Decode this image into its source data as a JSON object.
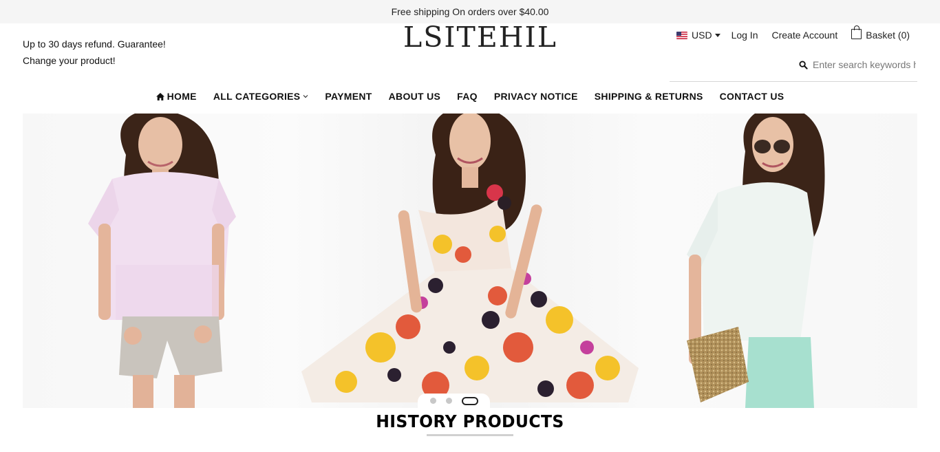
{
  "topbar": {
    "text": "Free shipping On orders over $40.00"
  },
  "promo": {
    "line1": "Up to 30 days refund. Guarantee!",
    "line2": "Change your product!"
  },
  "logo": {
    "text": "LSITEHIL"
  },
  "account": {
    "currency": "USD",
    "login": "Log In",
    "create": "Create Account",
    "basket": "Basket (0)"
  },
  "search": {
    "placeholder": "Enter search keywords here"
  },
  "nav": {
    "items": [
      {
        "label": "HOME",
        "icon": "home-icon"
      },
      {
        "label": "ALL CATEGORIES",
        "icon": "chevron-down-icon"
      },
      {
        "label": "PAYMENT"
      },
      {
        "label": "ABOUT US"
      },
      {
        "label": "FAQ"
      },
      {
        "label": "PRIVACY NOTICE"
      },
      {
        "label": "SHIPPING & RETURNS"
      },
      {
        "label": "CONTACT US"
      }
    ]
  },
  "slider": {
    "slides": 3,
    "active": 3
  },
  "section": {
    "title": "HISTORY PRODUCTS"
  },
  "colors": {
    "topbar_bg": "#f5f5f5",
    "text": "#222222",
    "divider": "#d0d0d0"
  }
}
